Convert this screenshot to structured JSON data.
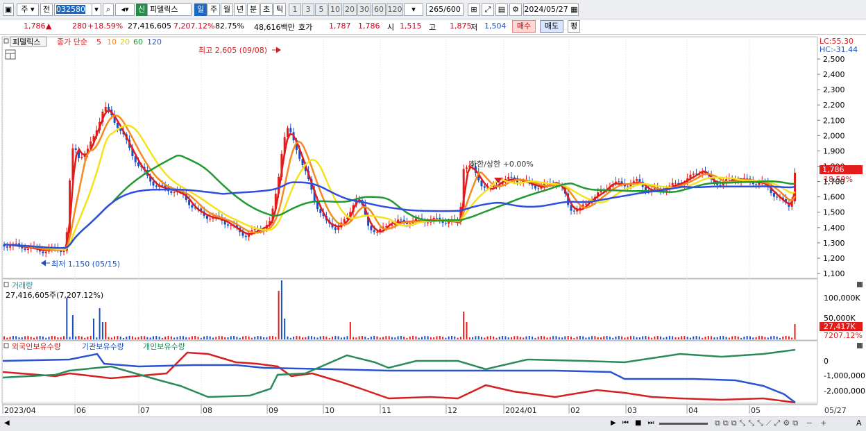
{
  "toolbar": {
    "market": "주",
    "prev": "전",
    "code": "032580",
    "credit": "신",
    "name": "피델릭스",
    "periods": [
      "일",
      "주",
      "월",
      "년",
      "분",
      "초",
      "틱"
    ],
    "active_period": "일",
    "intervals": [
      "1",
      "3",
      "5",
      "10",
      "20",
      "30",
      "60",
      "120"
    ],
    "count": "265",
    "count_max": "/600",
    "date": "2024/05/27"
  },
  "info": {
    "price": "1,786",
    "change": "280",
    "change_pct": "+18.59%",
    "volume": "27,416,605",
    "vol_pct": "7,207.12%",
    "turnover": "82.75%",
    "amount": "48,616백만",
    "ask_label": "호가",
    "ask": "1,787",
    "bid": "1,786",
    "open_label": "시",
    "open": "1,515",
    "high_label": "고",
    "high": "1,875",
    "low_label": "저",
    "low": "1,504",
    "buy": "매수",
    "sell": "매도",
    "eval": "평"
  },
  "price_panel": {
    "name_tag": "피델릭스",
    "legend": [
      "종가 단순",
      "5",
      "10",
      "20",
      "60",
      "120"
    ],
    "ma_colors": [
      "#e21b1b",
      "#f58a1e",
      "#f4e21a",
      "#1f9a2f",
      "#2e4ee0"
    ],
    "lc": "LC:55.30",
    "hc": "HC:-31.44",
    "high_annot": "최고 2,605 (09/08)",
    "low_annot": "최저 1,150 (05/15)",
    "limit_annot": "하한/상한 +0.00%",
    "last_price": "1,786",
    "last_pct": "18.59%",
    "yticks": [
      "2,500",
      "2,400",
      "2,300",
      "2,200",
      "2,100",
      "2,000",
      "1,900",
      "1,800",
      "1,700",
      "1,600",
      "1,500",
      "1,400",
      "1,300",
      "1,200",
      "1,100"
    ]
  },
  "volume_panel": {
    "title": "거래량",
    "value": "27,416,605주(7,207.12%)",
    "yticks": [
      "100,000K",
      "50,000K"
    ],
    "last": "27,417K",
    "last_pct": "7207.12%"
  },
  "investor_panel": {
    "legend": [
      "외국인보유수량",
      "기관보유수량",
      "개인보유수량"
    ],
    "yticks": [
      "0",
      "-1,000,000",
      "-2,000,000"
    ]
  },
  "xaxis": [
    "2023/04",
    "06",
    "07",
    "08",
    "09",
    "10",
    "11",
    "12",
    "2024/01",
    "02",
    "03",
    "04",
    "05",
    "05/27"
  ],
  "chart_data": {
    "type": "line",
    "title": "",
    "high": 2605,
    "low": 1150,
    "last": 1786,
    "ylim": [
      1100,
      2550
    ]
  }
}
